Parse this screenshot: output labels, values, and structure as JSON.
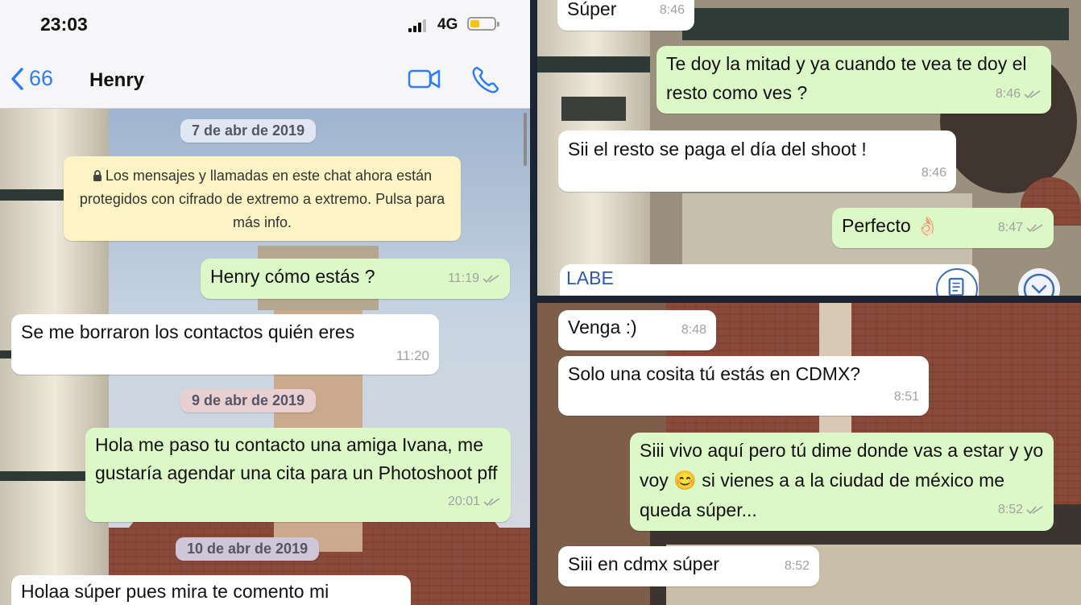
{
  "status_bar": {
    "time": "23:03",
    "network": "4G"
  },
  "header": {
    "back_count": "66",
    "contact_name": "Henry"
  },
  "icons": {
    "back": "chevron-left-icon",
    "video": "video-call-icon",
    "phone": "phone-icon",
    "lock": "lock-icon",
    "scroll": "scroll-down-icon",
    "attach": "document-icon"
  },
  "colors": {
    "accent": "#2f7cf6",
    "outgoing_bubble": "#dcf8c6",
    "incoming_bubble": "#ffffff",
    "notice_bg": "#fcf4c4"
  },
  "left_chat": {
    "dates": [
      "7 de abr de 2019",
      "9 de abr de 2019",
      "10 de abr de 2019"
    ],
    "encryption_notice": "Los mensajes y llamadas en este chat ahora están protegidos con cifrado de extremo a extremo. Pulsa para más info.",
    "messages": [
      {
        "text": "Henry cómo estás ?",
        "time": "11:19",
        "dir": "out"
      },
      {
        "text": "Se me borraron los contactos quién eres",
        "time": "11:20",
        "dir": "in"
      },
      {
        "text": "Hola me paso tu contacto una amiga Ivana, me gustaría agendar una cita para un Photoshoot pff",
        "time": "20:01",
        "dir": "out"
      },
      {
        "text": "Holaa súper pues mira te comento mi",
        "time": "",
        "dir": "in"
      }
    ]
  },
  "top_right_chat": {
    "messages": [
      {
        "text": "Súper",
        "time": "8:46",
        "dir": "in"
      },
      {
        "text": "Te doy la mitad y ya cuando te vea te doy el resto como ves ?",
        "time": "8:46",
        "dir": "out"
      },
      {
        "text": "Sii el resto se paga el día del shoot !",
        "time": "8:46",
        "dir": "in"
      },
      {
        "text": "Perfecto 👌🏻",
        "time": "8:47",
        "dir": "out"
      }
    ],
    "composer_text": "LABE"
  },
  "bottom_right_chat": {
    "messages": [
      {
        "text": "Venga :)",
        "time": "8:48",
        "dir": "in"
      },
      {
        "text": "Solo una cosita tú estás en CDMX?",
        "time": "8:51",
        "dir": "in"
      },
      {
        "text": "Siii vivo aquí pero tú dime donde vas a estar y yo voy 😊 si vienes a a la ciudad de méxico me queda súper...",
        "time": "8:52",
        "dir": "out"
      },
      {
        "text": "Siii en cdmx súper",
        "time": "8:52",
        "dir": "in"
      }
    ]
  }
}
